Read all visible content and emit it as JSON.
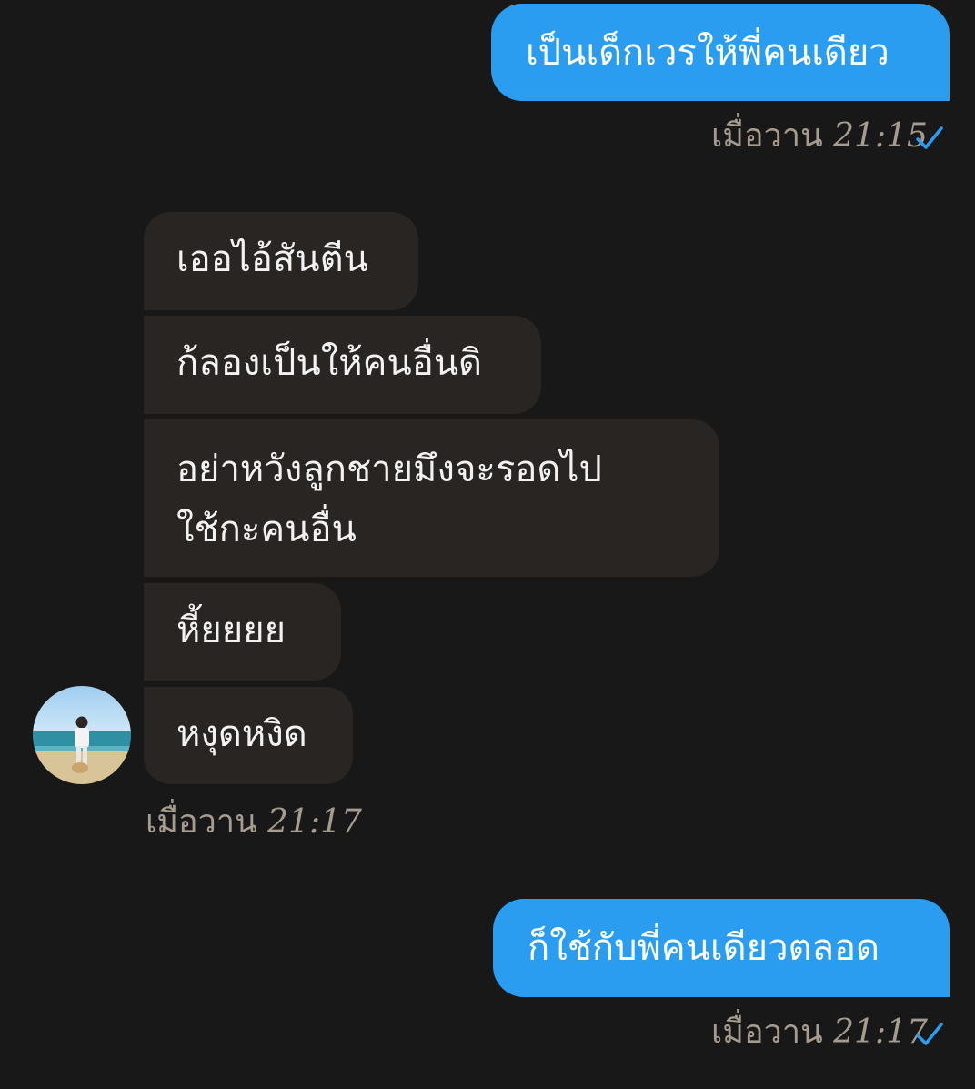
{
  "messages": {
    "m1": {
      "text": "เป็นเด็กเวรให้พี่คนเดียว",
      "date": "เมื่อวาน",
      "time": "21:15"
    },
    "m2": {
      "text": "เออไอ้สันตีน"
    },
    "m3": {
      "text": "ก้ลองเป็นให้คนอื่นดิ"
    },
    "m4": {
      "line1": "อย่าหวังลูกชายมึงจะรอดไป",
      "line2": "ใช้กะคนอื่น"
    },
    "m5": {
      "text": "หี้ยยยย"
    },
    "m6": {
      "text": "หงุดหงิด"
    },
    "incoming_meta": {
      "date": "เมื่อวาน",
      "time": "21:17"
    },
    "m7": {
      "text": "ก็ใช้กับพี่คนเดียวตลอด",
      "date": "เมื่อวาน",
      "time": "21:17"
    }
  },
  "icons": {
    "read_check": "check-icon",
    "avatar": "contact-avatar-beach-photo"
  },
  "colors": {
    "background": "#181818",
    "outgoing_bubble": "#2a9df0",
    "incoming_bubble": "#282522",
    "meta_text": "#a59b8f",
    "check": "#2a9df0"
  }
}
